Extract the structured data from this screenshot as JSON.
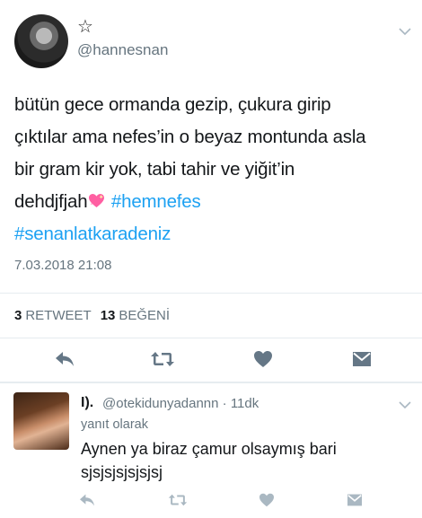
{
  "tweet": {
    "name_symbol": "☆",
    "handle": "@hannesnan",
    "text_lines": [
      "bütün gece ormanda gezip, çukura girip",
      "çıktılar ama nefes’in o beyaz montunda asla",
      "bir gram kir yok, tabi tahir ve yiğit’in"
    ],
    "text_line4": "dehdjfjah",
    "emoji": "sparkling-heart",
    "hashtag1": "#hemnefes",
    "hashtag2": "#senanlatkaradeniz",
    "timestamp": "7.03.2018 21:08",
    "retweet_count": "3",
    "retweet_label": "RETWEET",
    "like_count": "13",
    "like_label": "BEĞENİ"
  },
  "reply": {
    "name": "I).",
    "handle_time": "@otekidunyadannn · 11dk",
    "context": "yanıt olarak",
    "text_lines": [
      "Aynen ya biraz çamur olsaymış bari",
      "sjsjsjsjsjsjsj"
    ]
  },
  "colors": {
    "hashtag": "#1da1f2",
    "secondary_text": "#66757f",
    "action_icon": "#657786",
    "divider": "#e6ecf0"
  }
}
